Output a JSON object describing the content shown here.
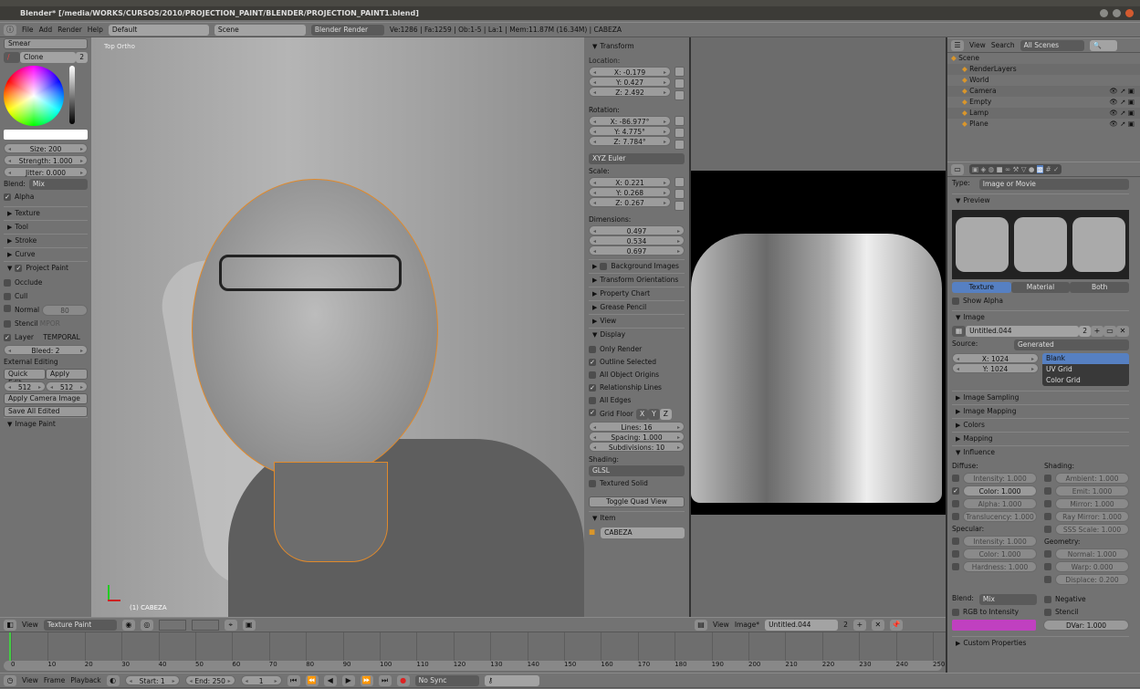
{
  "window": {
    "title": "Blender* [/media/WORKS/CURSOS/2010/PROJECTION_PAINT/BLENDER/PROJECTION_PAINT1.blend]"
  },
  "info_header": {
    "menus": [
      "File",
      "Add",
      "Render",
      "Help"
    ],
    "screen_layout": "Default",
    "scene": "Scene",
    "render_engine": "Blender Render",
    "stats": "Ve:1286 | Fa:1259 | Ob:1-5 | La:1 | Mem:11.87M (16.34M) | CABEZA"
  },
  "toolshelf": {
    "brush": "Smear",
    "brush_selector": "Clone",
    "brush_users": "2",
    "size": "Size: 200",
    "strength": "Strength: 1.000",
    "jitter": "Jitter: 0.000",
    "blend_label": "Blend:",
    "blend": "Mix",
    "alpha": "Alpha",
    "collapsed": [
      "Texture",
      "Tool",
      "Stroke",
      "Curve"
    ],
    "project_paint": "Project Paint",
    "occlude": "Occlude",
    "cull": "Cull",
    "normal": "Normal",
    "normal_value": "80",
    "stencil": "Stencil",
    "stencil_layer": "MPOR",
    "layer": "Layer",
    "layer_name": "TEMPORAL",
    "bleed": "Bleed: 2",
    "external_editing": "External Editing",
    "quick_edit": "Quick Edit",
    "apply": "Apply",
    "res_x": "512",
    "res_y": "512",
    "apply_camera_image": "Apply Camera Image",
    "save_all_edited": "Save All Edited",
    "image_paint": "Image Paint"
  },
  "viewport": {
    "view_label": "Top Ortho",
    "object_label": "(1) CABEZA",
    "header": {
      "view": "View",
      "mode": "Texture Paint"
    }
  },
  "npanel": {
    "transform": "Transform",
    "location_label": "Location:",
    "location": [
      "X: -0.179",
      "Y: 0.427",
      "Z: 2.492"
    ],
    "rotation_label": "Rotation:",
    "rotation": [
      "X: -86.977°",
      "Y: 4.775°",
      "Z: 7.784°"
    ],
    "rotation_mode": "XYZ Euler",
    "scale_label": "Scale:",
    "scale": [
      "X: 0.221",
      "Y: 0.268",
      "Z: 0.267"
    ],
    "dimensions_label": "Dimensions:",
    "dimensions": [
      "0.497",
      "0.534",
      "0.697"
    ],
    "collapsed": [
      "Background Images",
      "Transform Orientations",
      "Property Chart",
      "Grease Pencil",
      "View"
    ],
    "display": "Display",
    "only_render": "Only Render",
    "outline_selected": "Outline Selected",
    "all_object_origins": "All Object Origins",
    "relationship_lines": "Relationship Lines",
    "all_edges": "All Edges",
    "grid_floor": "Grid Floor",
    "axes": [
      "X",
      "Y",
      "Z"
    ],
    "lines": "Lines: 16",
    "spacing": "Spacing: 1.000",
    "subdivisions": "Subdivisions: 10",
    "shading_label": "Shading:",
    "shading": "GLSL",
    "textured_solid": "Textured Solid",
    "toggle_quad_view": "Toggle Quad View",
    "item": "Item",
    "item_name": "CABEZA"
  },
  "image_editor": {
    "header": {
      "view": "View",
      "image": "Image*",
      "image_name": "Untitled.044",
      "users": "2"
    }
  },
  "outliner": {
    "view": "View",
    "search": "Search",
    "filter": "All Scenes",
    "tree": [
      {
        "name": "Scene",
        "depth": 0
      },
      {
        "name": "RenderLayers",
        "depth": 1
      },
      {
        "name": "World",
        "depth": 1
      },
      {
        "name": "Camera",
        "depth": 1
      },
      {
        "name": "Empty",
        "depth": 1
      },
      {
        "name": "Lamp",
        "depth": 1
      },
      {
        "name": "Plane",
        "depth": 1
      }
    ]
  },
  "properties": {
    "type_label": "Type:",
    "type": "Image or Movie",
    "preview": "Preview",
    "preview_tabs": [
      "Texture",
      "Material",
      "Both"
    ],
    "show_alpha": "Show Alpha",
    "image": "Image",
    "image_name": "Untitled.044",
    "image_users": "2",
    "source_label": "Source:",
    "source": "Generated",
    "gen_x": "X: 1024",
    "gen_y": "Y: 1024",
    "gen_types": [
      "Blank",
      "UV Grid",
      "Color Grid"
    ],
    "collapsed": [
      "Image Sampling",
      "Image Mapping",
      "Colors",
      "Mapping"
    ],
    "influence": "Influence",
    "diffuse_label": "Diffuse:",
    "diffuse": [
      "Intensity: 1.000",
      "Color: 1.000",
      "Alpha: 1.000",
      "Translucency: 1.000"
    ],
    "specular_label": "Specular:",
    "specular": [
      "Intensity: 1.000",
      "Color: 1.000",
      "Hardness: 1.000"
    ],
    "shading_label": "Shading:",
    "shading": [
      "Ambient: 1.000",
      "Emit: 1.000",
      "Mirror: 1.000",
      "Ray Mirror: 1.000",
      "SSS Scale: 1.000"
    ],
    "geometry_label": "Geometry:",
    "geometry": [
      "Normal: 1.000",
      "Warp: 0.000",
      "Displace: 0.200"
    ],
    "blend_label": "Blend:",
    "blend": "Mix",
    "negative": "Negative",
    "rgb_to_intensity": "RGB to Intensity",
    "stencil": "Stencil",
    "dvar": "DVar: 1.000",
    "custom_properties": "Custom Properties",
    "color": "#c040c0"
  },
  "timeline": {
    "ticks": [
      "0",
      "10",
      "20",
      "30",
      "40",
      "50",
      "60",
      "70",
      "80",
      "90",
      "100",
      "110",
      "120",
      "130",
      "140",
      "150",
      "160",
      "170",
      "180",
      "190",
      "200",
      "210",
      "220",
      "230",
      "240",
      "250"
    ],
    "current_frame_value": 0,
    "menus": [
      "View",
      "Frame",
      "Playback"
    ],
    "start": "Start: 1",
    "end": "End: 250",
    "current": "1",
    "sync": "No Sync"
  },
  "colors": {
    "accent": "#5680c2",
    "selection_outline": "#e08a2c"
  }
}
